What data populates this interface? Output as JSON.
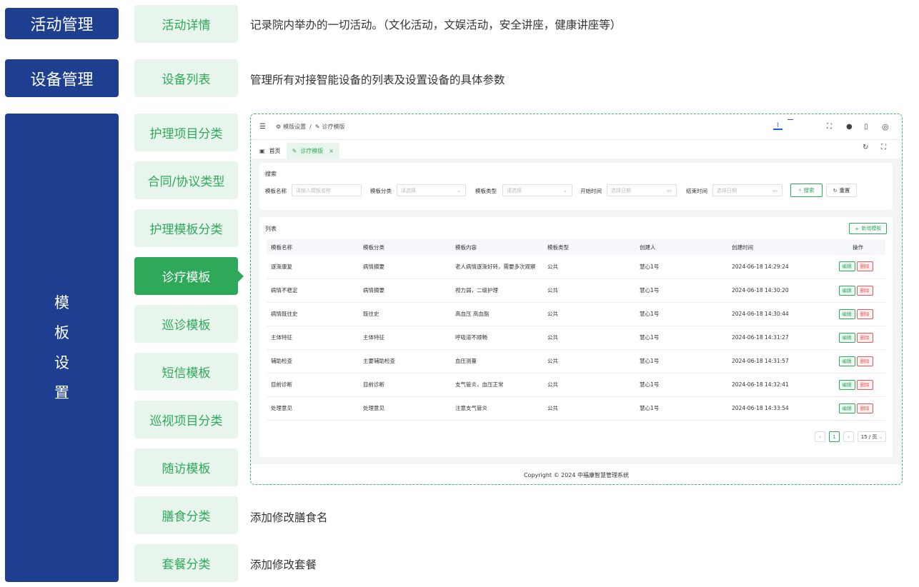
{
  "categories": [
    {
      "label": "活动管理"
    },
    {
      "label": "设备管理"
    },
    {
      "label_chars": [
        "模",
        "板",
        "设",
        "置"
      ]
    }
  ],
  "subitems": [
    {
      "label": "活动详情",
      "desc": "记录院内举办的一切活动。（文化活动，文娱活动，安全讲座，健康讲座等）"
    },
    {
      "label": "设备列表",
      "desc": "管理所有对接智能设备的列表及设置设备的具体参数"
    },
    {
      "label": "护理项目分类"
    },
    {
      "label": "合同/协议类型"
    },
    {
      "label": "护理模板分类"
    },
    {
      "label": "诊疗模板"
    },
    {
      "label": "巡诊模板"
    },
    {
      "label": "短信模板"
    },
    {
      "label": "巡视项目分类"
    },
    {
      "label": "随访模板"
    },
    {
      "label": "膳食分类",
      "desc": "添加修改膳食名"
    },
    {
      "label": "套餐分类",
      "desc": "添加修改套餐"
    }
  ],
  "app": {
    "breadcrumb": [
      "模版设置",
      "诊疗模版"
    ],
    "breadcrumb_sep": "/",
    "tabs": [
      {
        "label": "首页"
      },
      {
        "label": "诊疗模版"
      }
    ],
    "search": {
      "title": "搜索",
      "template_name_label": "模板名称",
      "template_name_placeholder": "请输入模板名称",
      "category_label": "模板分类",
      "category_placeholder": "请选择",
      "type_label": "模板类型",
      "type_placeholder": "请选择",
      "start_label": "开始时间",
      "start_placeholder": "选择日期",
      "end_label": "结束时间",
      "end_placeholder": "选择日期",
      "search_btn": "搜索",
      "reset_btn": "重置"
    },
    "list": {
      "title": "列表",
      "add_btn": "新增模板",
      "columns": [
        "模板名称",
        "模板分类",
        "模板内容",
        "模板类型",
        "创建人",
        "创建时间",
        "操作"
      ],
      "rows": [
        [
          "逐渐康复",
          "病情摘要",
          "老人病情逐渐好转，需要多次观察",
          "公共",
          "慧心1号",
          "2024-06-18 14:29:24"
        ],
        [
          "病情不稳定",
          "病情摘要",
          "视力弱，二级护理",
          "公共",
          "慧心1号",
          "2024-06-18 14:30:20"
        ],
        [
          "病情既往史",
          "既往史",
          "高血压 高血脂",
          "公共",
          "慧心1号",
          "2024-06-18 14:30:44"
        ],
        [
          "主体特征",
          "主体特征",
          "呼吸道不顺畅",
          "公共",
          "慧心1号",
          "2024-06-18 14:31:27"
        ],
        [
          "辅助检查",
          "主要辅助检查",
          "血压测量",
          "公共",
          "慧心1号",
          "2024-06-18 14:31:57"
        ],
        [
          "目前诊断",
          "目前诊断",
          "支气管炎，血压正常",
          "公共",
          "慧心1号",
          "2024-06-18 14:32:41"
        ],
        [
          "处理意见",
          "处理意见",
          "注意支气管炎",
          "公共",
          "慧心1号",
          "2024-06-18 14:33:54"
        ]
      ],
      "edit_label": "编辑",
      "delete_label": "删除"
    },
    "pagination": {
      "current": "1",
      "page_size": "15 / 页"
    },
    "footer": "Copyright © 2024 中福康智慧管理系统"
  }
}
